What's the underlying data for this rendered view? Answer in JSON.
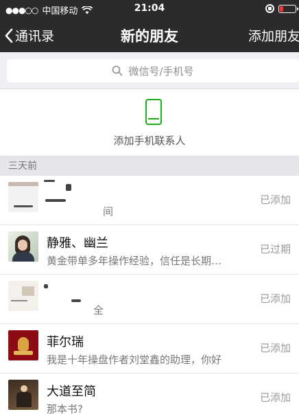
{
  "status_bar": {
    "signal": "●●●○○",
    "carrier": "中国移动",
    "time": "21:04"
  },
  "nav": {
    "back_label": "通讯录",
    "title": "新的朋友",
    "right_action": "添加朋友"
  },
  "search": {
    "placeholder": "微信号/手机号"
  },
  "add_contacts": {
    "label": "添加手机联系人"
  },
  "section": {
    "label": "三天前"
  },
  "requests": [
    {
      "name": "",
      "message": "间",
      "status": "已添加"
    },
    {
      "name": "静雅、幽兰",
      "message": "黄金带单多年操作经验，信任是长期…",
      "status": "已过期"
    },
    {
      "name": "",
      "message": "全",
      "status": "已添加"
    },
    {
      "name": "菲尔瑞",
      "message": "我是十年操盘作者刘堂鑫的助理，你好",
      "status": "已添加"
    },
    {
      "name": "大道至简",
      "message": "那本书?",
      "status": "已添加"
    }
  ],
  "colors": {
    "nav_bg": "#2b2b2e",
    "accent_green": "#1aad19",
    "battery_low": "#e23b3b"
  }
}
